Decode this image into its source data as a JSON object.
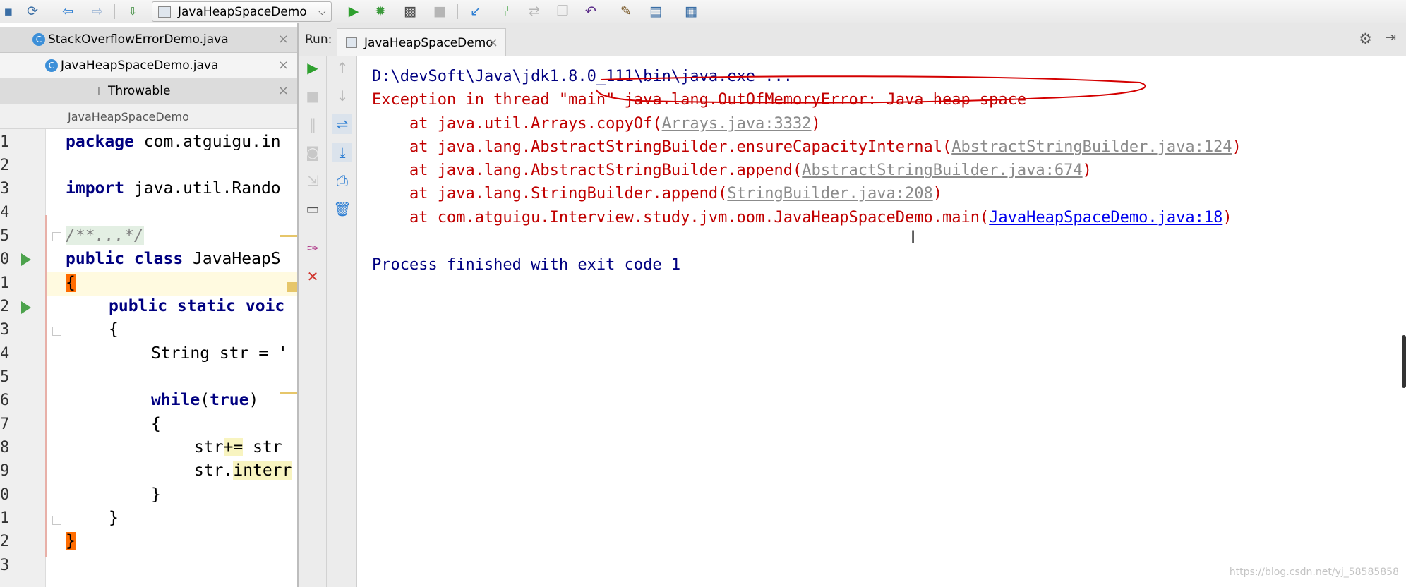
{
  "toolbar": {
    "run_config": "JavaHeapSpaceDemo",
    "icons": [
      "save-icon",
      "sync-icon",
      "back-arrow-icon",
      "forward-arrow-icon",
      "build-icon",
      "run-icon",
      "debug-icon",
      "coverage-icon",
      "stop-icon",
      "vcs-update-icon",
      "vcs-commit-icon",
      "vcs-compare-icon",
      "vcs-history-icon",
      "revert-icon",
      "settings-icon",
      "project-structure-icon",
      "sdk-icon"
    ]
  },
  "editor": {
    "tabs": [
      {
        "label": "StackOverflowErrorDemo.java"
      },
      {
        "label": "JavaHeapSpaceDemo.java"
      },
      {
        "label": "Throwable"
      }
    ],
    "close_glyph": "×",
    "breadcrumb": "JavaHeapSpaceDemo",
    "line_numbers": [
      "1",
      "2",
      "3",
      "4",
      "5",
      "0",
      "1",
      "2",
      "3",
      "4",
      "5",
      "6",
      "7",
      "8",
      "9",
      "0",
      "1",
      "2",
      "3"
    ],
    "code": {
      "l1_kw": "package",
      "l1_rest": " com.atguigu.in",
      "l3_kw": "import",
      "l3_rest": " java.util.Rando",
      "l5_comment": "/**...*/",
      "l6_kw": "public class",
      "l6_rest": " JavaHeapS",
      "l7_brace": "{",
      "l8_kw": "public static",
      "l8_rest": " voic",
      "l9": "{",
      "l10": "String str = '",
      "l12_kw": "while",
      "l12_p1": "(",
      "l12_kw2": "true",
      "l12_p2": ")",
      "l13": "{",
      "l14_a": "str",
      "l14_op": "+=",
      "l14_b": " str",
      "l15_a": "str.",
      "l15_b": "interr",
      "l16": "}",
      "l17": "}",
      "l18_brace": "}"
    }
  },
  "run": {
    "label": "Run:",
    "tab": "JavaHeapSpaceDemo",
    "console": {
      "cmd": "D:\\devSoft\\Java\\jdk1.8.0_111\\bin\\java.exe ...",
      "exception": "Exception in thread \"main\" java.lang.OutOfMemoryError: Java heap space",
      "stack": [
        {
          "prefix": "    at java.util.Arrays.copyOf(",
          "link": "Arrays.java:3332",
          "suffix": ")",
          "style": "grey"
        },
        {
          "prefix": "    at java.lang.AbstractStringBuilder.ensureCapacityInternal(",
          "link": "AbstractStringBuilder.java:124",
          "suffix": ")",
          "style": "grey"
        },
        {
          "prefix": "    at java.lang.AbstractStringBuilder.append(",
          "link": "AbstractStringBuilder.java:674",
          "suffix": ")",
          "style": "grey"
        },
        {
          "prefix": "    at java.lang.StringBuilder.append(",
          "link": "StringBuilder.java:208",
          "suffix": ")",
          "style": "grey"
        },
        {
          "prefix": "    at com.atguigu.Interview.study.jvm.oom.JavaHeapSpaceDemo.main(",
          "link": "JavaHeapSpaceDemo.java:18",
          "suffix": ")",
          "style": "blue"
        }
      ],
      "finished": "Process finished with exit code 1"
    }
  },
  "watermark": "https://blog.csdn.net/yj_58585858",
  "colors": {
    "accent_run": "#4ca24c",
    "error": "#c00000",
    "console_text": "#000080",
    "annotation": "#d40000"
  }
}
